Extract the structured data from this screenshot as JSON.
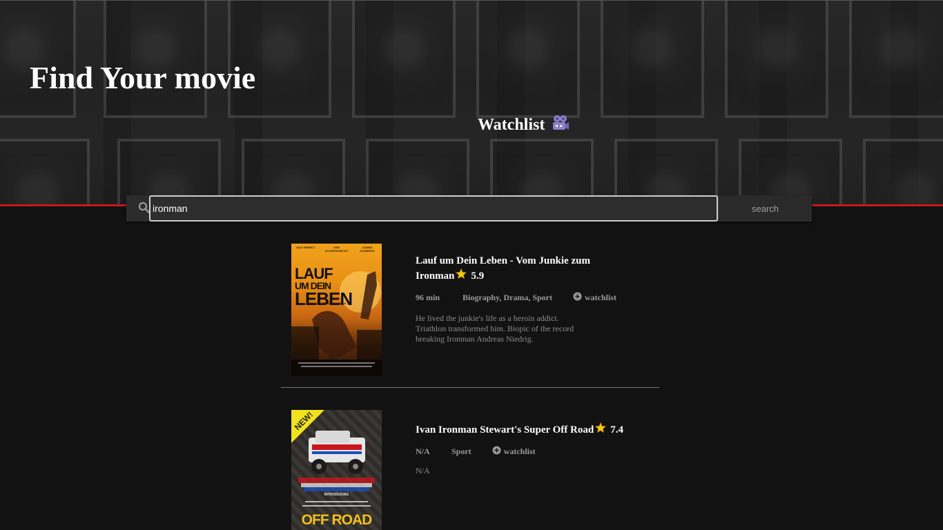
{
  "header": {
    "title": "Find Your movie",
    "watchlist_label": "Watchlist",
    "watchlist_icon": "movie-camera-icon"
  },
  "search": {
    "value": "ironman",
    "button_label": "search",
    "icon": "search-icon"
  },
  "colors": {
    "background": "#121212",
    "accent_line": "#c8161d",
    "star": "#f5c518",
    "muted_text": "#9a9a9a"
  },
  "results": [
    {
      "title": "Lauf um Dein Leben - Vom Junkie zum Ironman",
      "rating": "5.9",
      "runtime": "96 min",
      "genres": "Biography, Drama, Sport",
      "watchlist_label": "watchlist",
      "plot": "He lived the junkie's life as a heroin addict. Triathlon transformed him. Biopic of the record breaking Ironman Andreas Niedrig.",
      "poster": {
        "top_names": [
          "MAX RIEMELT",
          "UWE OCHSENKNECHT",
          "JASMIN SCHWIERS"
        ],
        "title_line1": "LAUF",
        "title_line2": "UM DEIN",
        "title_line3": "LEBEN",
        "subtitle": "VOM JUNKIE ZUM IRONMAN"
      }
    },
    {
      "title": "Ivan Ironman Stewart's Super Off Road",
      "rating": "7.4",
      "runtime": "N/A",
      "genres": "Sport",
      "watchlist_label": "watchlist",
      "plot": "N/A",
      "poster": {
        "badge": "NEW!",
        "intro": "INTRODUCING",
        "title": "OFF ROAD"
      }
    }
  ]
}
